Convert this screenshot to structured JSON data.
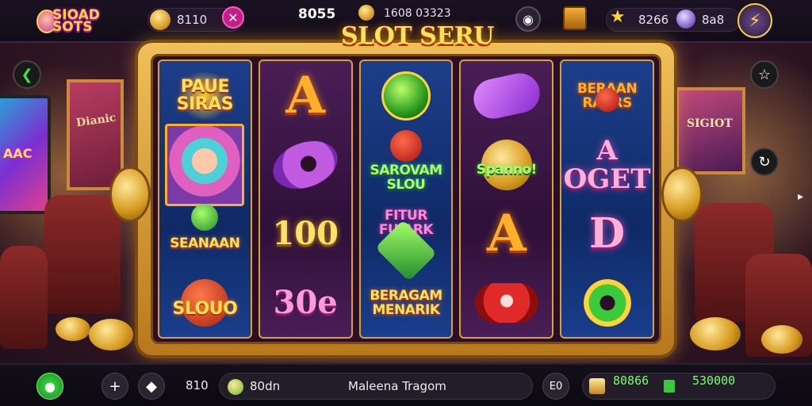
{
  "header": {
    "logo_text": "SIOAD SOTS",
    "coins_value": "8110",
    "score": "8055",
    "gold_value": "1608 03323",
    "gem_value": "8266",
    "crystal_value": "8a8"
  },
  "game": {
    "title": "SLOT SERU",
    "reels": [
      {
        "theme": "blue",
        "symbols": [
          "PAUE SIRAS",
          "",
          "SEANAAN",
          "SLOUO"
        ]
      },
      {
        "theme": "purple",
        "symbols": [
          "A",
          "",
          "100",
          "30e"
        ]
      },
      {
        "theme": "blue",
        "symbols": [
          "",
          "SAROVAM SLOU",
          "FITUR FUJARK",
          "BERAGAM MENARIK"
        ]
      },
      {
        "theme": "purple",
        "symbols": [
          "",
          "Spanno!",
          "A",
          ""
        ]
      },
      {
        "theme": "blue",
        "symbols": [
          "BERAAN RAARS",
          "A OGET",
          "D",
          ""
        ]
      }
    ]
  },
  "room": {
    "tv_text": "AAC",
    "poster_left": "Dianic",
    "poster_right": "SIGIOT"
  },
  "footer": {
    "bet_value": "810",
    "coin_value": "80dn",
    "message": "Maleena Tragom",
    "auto_label": "E0",
    "balance_a": "80866",
    "balance_b": "530000"
  },
  "colors": {
    "accent_gold": "#ffd43a",
    "frame": "#d9a03a",
    "green": "#7aff6a"
  }
}
